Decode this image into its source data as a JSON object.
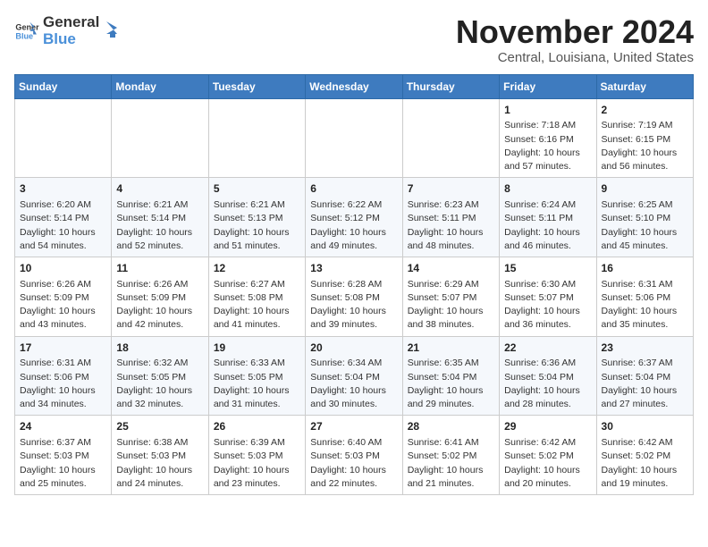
{
  "header": {
    "logo_general": "General",
    "logo_blue": "Blue",
    "month_title": "November 2024",
    "location": "Central, Louisiana, United States"
  },
  "days_of_week": [
    "Sunday",
    "Monday",
    "Tuesday",
    "Wednesday",
    "Thursday",
    "Friday",
    "Saturday"
  ],
  "weeks": [
    [
      null,
      null,
      null,
      null,
      null,
      {
        "day": "1",
        "sunrise": "Sunrise: 7:18 AM",
        "sunset": "Sunset: 6:16 PM",
        "daylight": "Daylight: 10 hours and 57 minutes."
      },
      {
        "day": "2",
        "sunrise": "Sunrise: 7:19 AM",
        "sunset": "Sunset: 6:15 PM",
        "daylight": "Daylight: 10 hours and 56 minutes."
      }
    ],
    [
      {
        "day": "3",
        "sunrise": "Sunrise: 6:20 AM",
        "sunset": "Sunset: 5:14 PM",
        "daylight": "Daylight: 10 hours and 54 minutes."
      },
      {
        "day": "4",
        "sunrise": "Sunrise: 6:21 AM",
        "sunset": "Sunset: 5:14 PM",
        "daylight": "Daylight: 10 hours and 52 minutes."
      },
      {
        "day": "5",
        "sunrise": "Sunrise: 6:21 AM",
        "sunset": "Sunset: 5:13 PM",
        "daylight": "Daylight: 10 hours and 51 minutes."
      },
      {
        "day": "6",
        "sunrise": "Sunrise: 6:22 AM",
        "sunset": "Sunset: 5:12 PM",
        "daylight": "Daylight: 10 hours and 49 minutes."
      },
      {
        "day": "7",
        "sunrise": "Sunrise: 6:23 AM",
        "sunset": "Sunset: 5:11 PM",
        "daylight": "Daylight: 10 hours and 48 minutes."
      },
      {
        "day": "8",
        "sunrise": "Sunrise: 6:24 AM",
        "sunset": "Sunset: 5:11 PM",
        "daylight": "Daylight: 10 hours and 46 minutes."
      },
      {
        "day": "9",
        "sunrise": "Sunrise: 6:25 AM",
        "sunset": "Sunset: 5:10 PM",
        "daylight": "Daylight: 10 hours and 45 minutes."
      }
    ],
    [
      {
        "day": "10",
        "sunrise": "Sunrise: 6:26 AM",
        "sunset": "Sunset: 5:09 PM",
        "daylight": "Daylight: 10 hours and 43 minutes."
      },
      {
        "day": "11",
        "sunrise": "Sunrise: 6:26 AM",
        "sunset": "Sunset: 5:09 PM",
        "daylight": "Daylight: 10 hours and 42 minutes."
      },
      {
        "day": "12",
        "sunrise": "Sunrise: 6:27 AM",
        "sunset": "Sunset: 5:08 PM",
        "daylight": "Daylight: 10 hours and 41 minutes."
      },
      {
        "day": "13",
        "sunrise": "Sunrise: 6:28 AM",
        "sunset": "Sunset: 5:08 PM",
        "daylight": "Daylight: 10 hours and 39 minutes."
      },
      {
        "day": "14",
        "sunrise": "Sunrise: 6:29 AM",
        "sunset": "Sunset: 5:07 PM",
        "daylight": "Daylight: 10 hours and 38 minutes."
      },
      {
        "day": "15",
        "sunrise": "Sunrise: 6:30 AM",
        "sunset": "Sunset: 5:07 PM",
        "daylight": "Daylight: 10 hours and 36 minutes."
      },
      {
        "day": "16",
        "sunrise": "Sunrise: 6:31 AM",
        "sunset": "Sunset: 5:06 PM",
        "daylight": "Daylight: 10 hours and 35 minutes."
      }
    ],
    [
      {
        "day": "17",
        "sunrise": "Sunrise: 6:31 AM",
        "sunset": "Sunset: 5:06 PM",
        "daylight": "Daylight: 10 hours and 34 minutes."
      },
      {
        "day": "18",
        "sunrise": "Sunrise: 6:32 AM",
        "sunset": "Sunset: 5:05 PM",
        "daylight": "Daylight: 10 hours and 32 minutes."
      },
      {
        "day": "19",
        "sunrise": "Sunrise: 6:33 AM",
        "sunset": "Sunset: 5:05 PM",
        "daylight": "Daylight: 10 hours and 31 minutes."
      },
      {
        "day": "20",
        "sunrise": "Sunrise: 6:34 AM",
        "sunset": "Sunset: 5:04 PM",
        "daylight": "Daylight: 10 hours and 30 minutes."
      },
      {
        "day": "21",
        "sunrise": "Sunrise: 6:35 AM",
        "sunset": "Sunset: 5:04 PM",
        "daylight": "Daylight: 10 hours and 29 minutes."
      },
      {
        "day": "22",
        "sunrise": "Sunrise: 6:36 AM",
        "sunset": "Sunset: 5:04 PM",
        "daylight": "Daylight: 10 hours and 28 minutes."
      },
      {
        "day": "23",
        "sunrise": "Sunrise: 6:37 AM",
        "sunset": "Sunset: 5:04 PM",
        "daylight": "Daylight: 10 hours and 27 minutes."
      }
    ],
    [
      {
        "day": "24",
        "sunrise": "Sunrise: 6:37 AM",
        "sunset": "Sunset: 5:03 PM",
        "daylight": "Daylight: 10 hours and 25 minutes."
      },
      {
        "day": "25",
        "sunrise": "Sunrise: 6:38 AM",
        "sunset": "Sunset: 5:03 PM",
        "daylight": "Daylight: 10 hours and 24 minutes."
      },
      {
        "day": "26",
        "sunrise": "Sunrise: 6:39 AM",
        "sunset": "Sunset: 5:03 PM",
        "daylight": "Daylight: 10 hours and 23 minutes."
      },
      {
        "day": "27",
        "sunrise": "Sunrise: 6:40 AM",
        "sunset": "Sunset: 5:03 PM",
        "daylight": "Daylight: 10 hours and 22 minutes."
      },
      {
        "day": "28",
        "sunrise": "Sunrise: 6:41 AM",
        "sunset": "Sunset: 5:02 PM",
        "daylight": "Daylight: 10 hours and 21 minutes."
      },
      {
        "day": "29",
        "sunrise": "Sunrise: 6:42 AM",
        "sunset": "Sunset: 5:02 PM",
        "daylight": "Daylight: 10 hours and 20 minutes."
      },
      {
        "day": "30",
        "sunrise": "Sunrise: 6:42 AM",
        "sunset": "Sunset: 5:02 PM",
        "daylight": "Daylight: 10 hours and 19 minutes."
      }
    ]
  ]
}
